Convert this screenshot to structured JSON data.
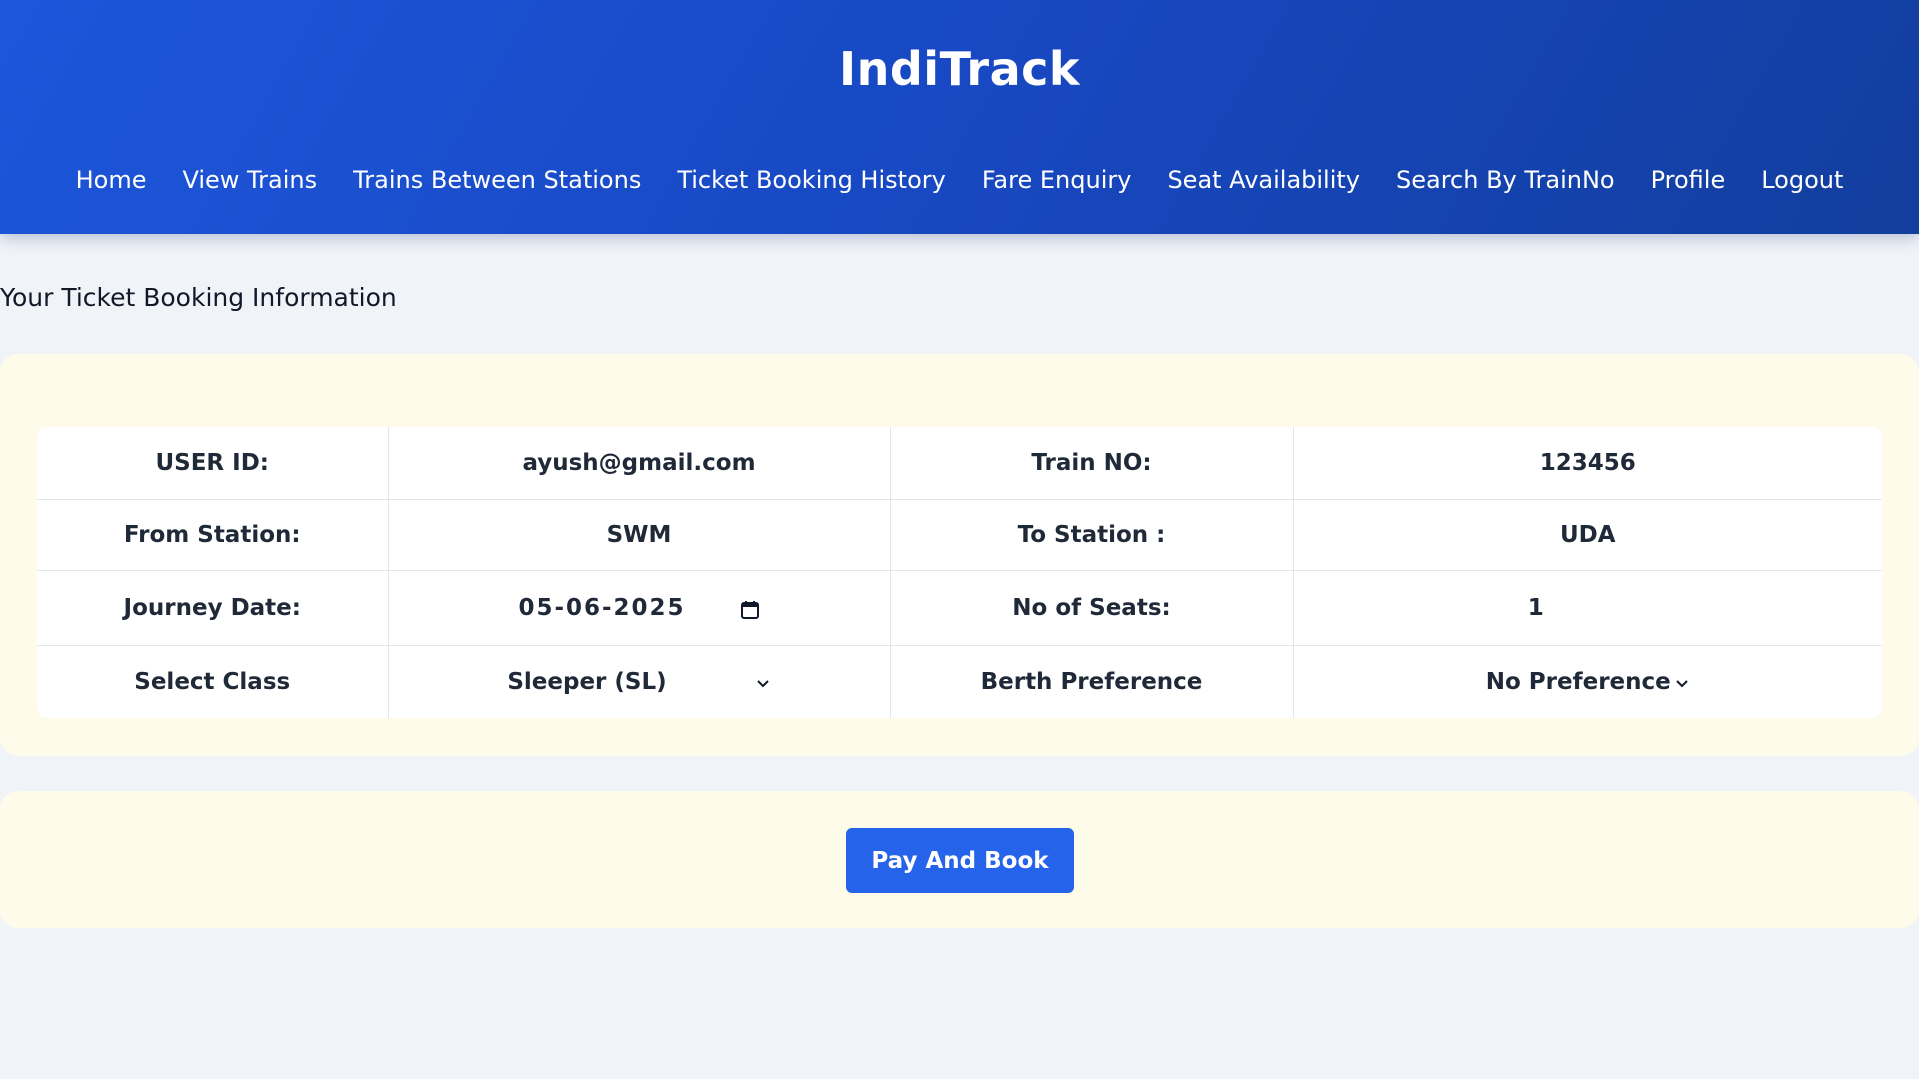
{
  "header": {
    "brand": "IndiTrack",
    "nav": [
      "Home",
      "View Trains",
      "Trains Between Stations",
      "Ticket Booking History",
      "Fare Enquiry",
      "Seat Availability",
      "Search By TrainNo",
      "Profile",
      "Logout"
    ]
  },
  "page": {
    "heading": "Your Ticket Booking Information"
  },
  "booking": {
    "user_id_label": "USER ID:",
    "user_id": "ayush@gmail.com",
    "train_no_label": "Train NO:",
    "train_no": "123456",
    "from_label": "From Station:",
    "from": "SWM",
    "to_label": "To Station :",
    "to": "UDA",
    "journey_date_label": "Journey Date:",
    "journey_date": "05-06-2025",
    "seats_label": "No of Seats:",
    "seats": "1",
    "class_label": "Select Class",
    "class_value": "Sleeper (SL)",
    "berth_label": "Berth Preference",
    "berth_value": "No Preference"
  },
  "actions": {
    "pay_button": "Pay And Book"
  },
  "colors": {
    "header": "#1d56db",
    "card": "#fffbea",
    "button": "#2563eb",
    "background": "#f0f3f8"
  },
  "icons": {
    "date": "calendar-icon",
    "select": "chevron-down-icon"
  }
}
